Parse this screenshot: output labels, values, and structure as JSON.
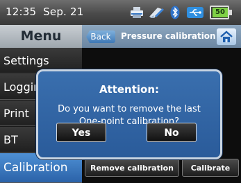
{
  "status": {
    "time": "12:35",
    "date": "Sep. 21",
    "battery": "50",
    "icons": [
      "printer-icon",
      "probe-icon",
      "bluetooth-icon",
      "usb-icon",
      "battery-icon"
    ]
  },
  "header": {
    "menu_title": "Menu",
    "back_label": "Back",
    "screen_title": "Pressure calibration",
    "home_icon": "home-icon"
  },
  "sidebar": {
    "items": [
      {
        "label": "Settings"
      },
      {
        "label": "Logging"
      },
      {
        "label": "Print"
      },
      {
        "label": "BT"
      },
      {
        "label": "Calibration"
      }
    ]
  },
  "actions": {
    "remove_label": "Remove calibration",
    "calibrate_label": "Calibrate"
  },
  "dialog": {
    "title": "Attention:",
    "line1": "Do you want to remove the last",
    "line2": "One-point calibration?",
    "yes_label": "Yes",
    "no_label": "No"
  },
  "colors": {
    "accent": "#2b62a8",
    "dialog": "#2f63a3",
    "battery": "#7fd146"
  }
}
